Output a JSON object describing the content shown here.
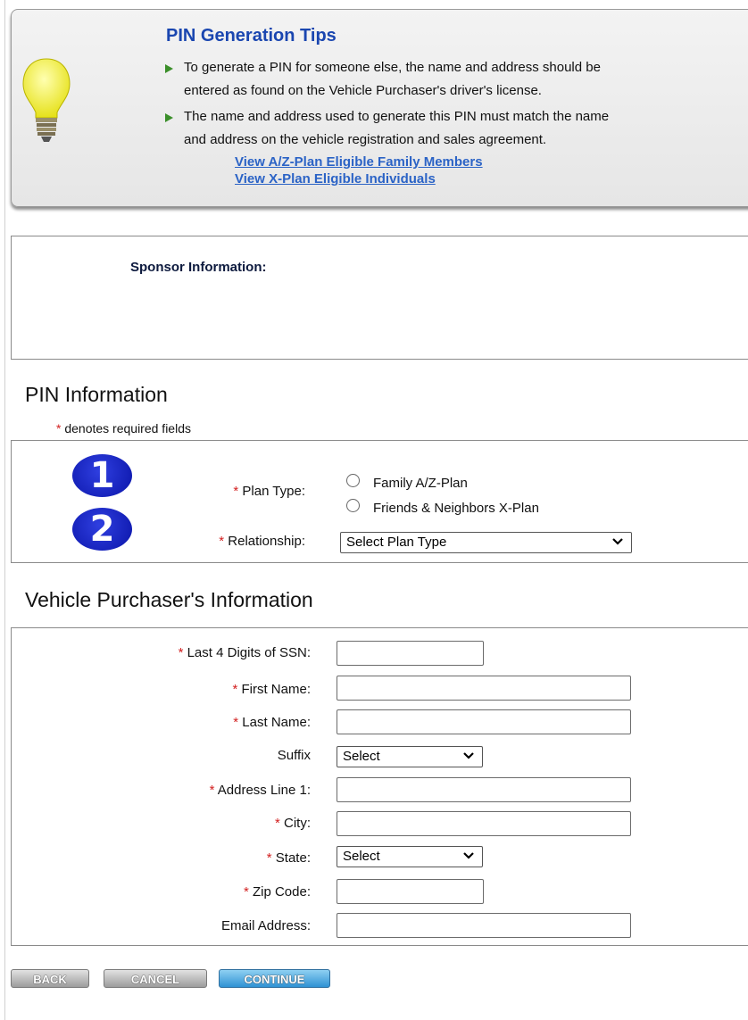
{
  "tips": {
    "title": "PIN Generation Tips",
    "lines": [
      "To generate a PIN for someone else, the name and address should be",
      "entered as found on the Vehicle Purchaser's driver's license.",
      "The name and address used to generate this PIN must match the name",
      "and address on the vehicle registration and sales agreement."
    ],
    "links": [
      "View A/Z-Plan Eligible Family Members",
      "View X-Plan Eligible Individuals"
    ]
  },
  "sponsor": {
    "label": "Sponsor Information:"
  },
  "pin_section": {
    "heading": "PIN Information",
    "required_note": "denotes required fields",
    "plan_type_label": "Plan Type:",
    "plan_options": [
      "Family A/Z-Plan",
      "Friends & Neighbors X-Plan"
    ],
    "relationship_label": "Relationship:",
    "relationship_value": "Select Plan Type",
    "markers": [
      "1",
      "2"
    ]
  },
  "vehicle_section": {
    "heading": "Vehicle Purchaser's Information",
    "fields": {
      "ssn_label": "Last 4 Digits of SSN:",
      "first_name_label": "First Name:",
      "last_name_label": "Last Name:",
      "suffix_label": "Suffix",
      "suffix_value": "Select",
      "address1_label": "Address Line 1:",
      "city_label": "City:",
      "state_label": "State:",
      "state_value": "Select",
      "zip_label": "Zip Code:",
      "email_label": "Email Address:"
    }
  },
  "buttons": {
    "back": "BACK",
    "cancel": "CANCEL",
    "continue": "CONTINUE"
  },
  "colors": {
    "tips_title": "#1a46b0",
    "link": "#2b63c6",
    "required_star": "#d21f1f",
    "marker_badge": "#1a22c8",
    "continue_button": "#3a9bd9"
  },
  "icons": {
    "bulb": "lightbulb-icon",
    "tip_bullet": "arrow-right-icon",
    "dropdown": "chevron-down-icon"
  }
}
